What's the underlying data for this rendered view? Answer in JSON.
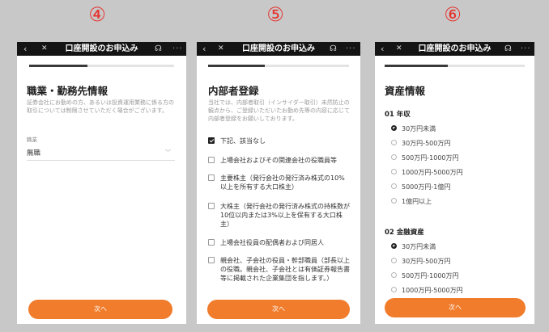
{
  "step_markers": [
    "④",
    "⑤",
    "⑥"
  ],
  "colors": {
    "step_marker": "#e5322d",
    "next_button": "#f07c2c",
    "topbar": "#141414",
    "background": "#c8c8c8"
  },
  "topbar": {
    "title": "口座開設のお申込み",
    "back_icon": "‹",
    "close_icon": "✕",
    "headset_icon": "☊",
    "more_icon": "···"
  },
  "phone4": {
    "progress": 0.4,
    "heading": "職業・勤務先情報",
    "description": "証券会社にお勤めの方、あるいは投資運用業務に係る方の取引については制限させていただく場合がございます。",
    "field_label": "職業",
    "field_value": "無職",
    "next_label": "次へ"
  },
  "phone5": {
    "progress": 0.4,
    "heading": "内部者登録",
    "description": "当社では、内部者取引（インサイダー取引）未然防止の観点から、ご登録いただいたお勤め先等の内容に応じて内部者登録をお願いしております。",
    "options": [
      {
        "label": "下記、該当なし",
        "checked": true
      },
      {
        "label": "上場会社およびその関連会社の役職員等",
        "checked": false
      },
      {
        "label": "主要株主（発行会社の発行済み株式の10%以上を所有する大口株主）",
        "checked": false
      },
      {
        "label": "大株主（発行会社の発行済み株式の持株数が10位以内または3%以上を保有する大口株主）",
        "checked": false
      },
      {
        "label": "上場会社役員の配偶者および同居人",
        "checked": false
      },
      {
        "label": "親会社、子会社の役員・幹部職員（部長以上の役職。親会社、子会社とは有価証券報告書等に掲載された企業集団を指します。）",
        "checked": false
      }
    ],
    "next_label": "次へ"
  },
  "phone6": {
    "progress": 0.45,
    "heading": "資産情報",
    "sections": [
      {
        "title": "01 年収",
        "options": [
          {
            "label": "30万円未満",
            "selected": true
          },
          {
            "label": "30万円-500万円",
            "selected": false
          },
          {
            "label": "500万円-1000万円",
            "selected": false
          },
          {
            "label": "1000万円-5000万円",
            "selected": false
          },
          {
            "label": "5000万円-1億円",
            "selected": false
          },
          {
            "label": "1億円以上",
            "selected": false
          }
        ]
      },
      {
        "title": "02 金融資産",
        "options": [
          {
            "label": "30万円未満",
            "selected": true
          },
          {
            "label": "30万円-500万円",
            "selected": false
          },
          {
            "label": "500万円-1000万円",
            "selected": false
          },
          {
            "label": "1000万円-5000万円",
            "selected": false
          }
        ]
      }
    ],
    "next_label": "次へ"
  }
}
